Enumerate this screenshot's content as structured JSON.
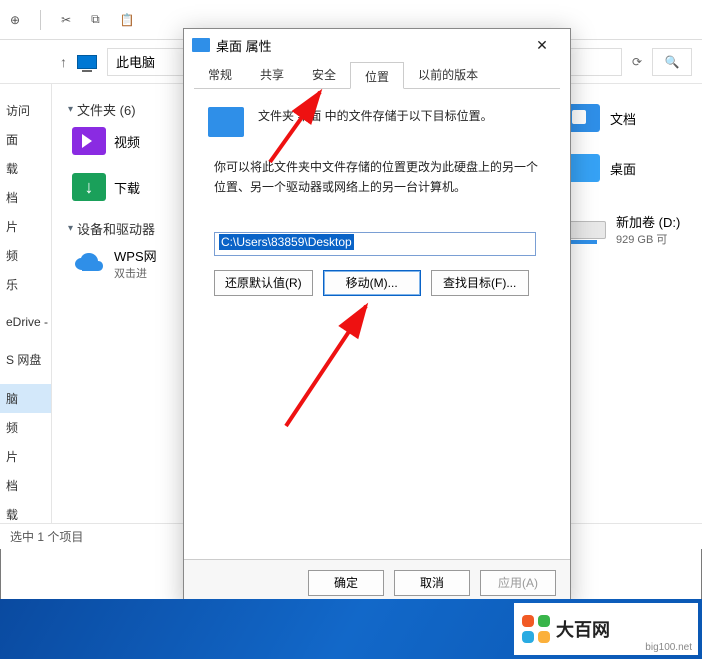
{
  "toolbar": {
    "cut_icon": "cut-icon",
    "copy_icon": "copy-icon",
    "paste_icon": "paste-icon"
  },
  "nav": {
    "up_arrow": "↑",
    "breadcrumb": "此电脑"
  },
  "sidebar": {
    "items": [
      "访问",
      "面",
      "载",
      "档",
      "片",
      "频",
      "乐",
      "eDrive - Pers",
      "S 网盘",
      "脑",
      "频",
      "片",
      "档",
      "载"
    ],
    "selected_index": 9
  },
  "groups": {
    "folders_header": "文件夹 (6)",
    "devices_header": "设备和驱动器"
  },
  "left_items": {
    "video": "视频",
    "download": "下载",
    "wps": "WPS网",
    "wps_sub": "双击进"
  },
  "right_items": {
    "docs": "文档",
    "desktop": "桌面",
    "drive_name": "新加卷 (D:)",
    "drive_sub": "929 GB 可"
  },
  "statusbar": {
    "text": "选中 1 个项目"
  },
  "dialog": {
    "title": "桌面 属性",
    "tabs": [
      "常规",
      "共享",
      "安全",
      "位置",
      "以前的版本"
    ],
    "active_tab_index": 3,
    "info_line": "文件夹 桌面 中的文件存储于以下目标位置。",
    "desc_line1": "你可以将此文件夹中文件存储的位置更改为此硬盘上的另一个",
    "desc_line2": "位置、另一个驱动器或网络上的另一台计算机。",
    "path_value": "C:\\Users\\83859\\Desktop",
    "btn_restore": "还原默认值(R)",
    "btn_move": "移动(M)...",
    "btn_find": "查找目标(F)...",
    "btn_ok": "确定",
    "btn_cancel": "取消",
    "btn_apply": "应用(A)"
  },
  "watermark": {
    "name": "大百网",
    "url": "big100.net"
  }
}
